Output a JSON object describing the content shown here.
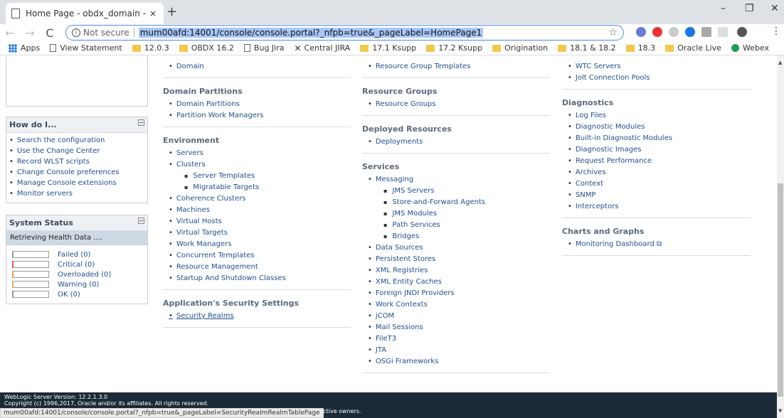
{
  "browser": {
    "tab_title": "Home Page - obdx_domain - WL",
    "tab_close": "×",
    "new_tab": "+",
    "minimize": "–",
    "restore": "❐",
    "close": "✕",
    "back": "←",
    "forward": "→",
    "reload": "C",
    "info_glyph": "i",
    "not_secure": "Not secure",
    "url": "mum00afd:14001/console/console.portal?_nfpb=true&_pageLabel=HomePage1",
    "star": "☆",
    "menu": "⋮",
    "bookmarks": [
      {
        "label": "Apps",
        "icon": "apps-icon"
      },
      {
        "label": "View Statement",
        "icon": "page-icon"
      },
      {
        "label": "12.0.3",
        "icon": "folder-icon"
      },
      {
        "label": "OBDX 16.2",
        "icon": "folder-icon"
      },
      {
        "label": "Bug Jira",
        "icon": "page-icon"
      },
      {
        "label": "Central JIRA",
        "icon": "jira-icon"
      },
      {
        "label": "17.1 Ksupp",
        "icon": "folder-icon"
      },
      {
        "label": "17.2 Ksupp",
        "icon": "folder-icon"
      },
      {
        "label": "Origination",
        "icon": "folder-icon"
      },
      {
        "label": "18.1 & 18.2",
        "icon": "folder-icon"
      },
      {
        "label": "18.3",
        "icon": "folder-icon"
      },
      {
        "label": "Oracle Live",
        "icon": "folder-icon"
      },
      {
        "label": "Webex",
        "icon": "webex-icon"
      }
    ]
  },
  "left": {
    "howdoi_title": "How do I...",
    "howdoi_items": [
      "Search the configuration",
      "Use the Change Center",
      "Record WLST scripts",
      "Change Console preferences",
      "Manage Console extensions",
      "Monitor servers"
    ],
    "status_title": "System Status",
    "retrieving": "Retrieving Health Data ....",
    "health": [
      {
        "label": "Failed (0)",
        "color": "#999999"
      },
      {
        "label": "Critical (0)",
        "color": "#d9534f"
      },
      {
        "label": "Overloaded (0)",
        "color": "#e8a33d"
      },
      {
        "label": "Warning (0)",
        "color": "#e0b84a"
      },
      {
        "label": "OK (0)",
        "color": "#999999"
      }
    ]
  },
  "col1": [
    {
      "title": "",
      "items": [
        {
          "label": "Domain"
        }
      ]
    },
    {
      "title": "Domain Partitions",
      "items": [
        {
          "label": "Domain Partitions"
        },
        {
          "label": "Partition Work Managers"
        }
      ]
    },
    {
      "title": "Environment",
      "items": [
        {
          "label": "Servers"
        },
        {
          "label": "Clusters"
        },
        {
          "label": "Server Templates",
          "sub": true
        },
        {
          "label": "Migratable Targets",
          "sub": true
        },
        {
          "label": "Coherence Clusters"
        },
        {
          "label": "Machines"
        },
        {
          "label": "Virtual Hosts"
        },
        {
          "label": "Virtual Targets"
        },
        {
          "label": "Work Managers"
        },
        {
          "label": "Concurrent Templates"
        },
        {
          "label": "Resource Management"
        },
        {
          "label": "Startup And Shutdown Classes"
        }
      ]
    },
    {
      "title": "Application's Security Settings",
      "items": [
        {
          "label": "Security Realms",
          "u": true
        }
      ]
    }
  ],
  "col2": [
    {
      "title": "",
      "items": [
        {
          "label": "Resource Group Templates"
        }
      ]
    },
    {
      "title": "Resource Groups",
      "items": [
        {
          "label": "Resource Groups"
        }
      ]
    },
    {
      "title": "Deployed Resources",
      "items": [
        {
          "label": "Deployments"
        }
      ]
    },
    {
      "title": "Services",
      "items": [
        {
          "label": "Messaging"
        },
        {
          "label": "JMS Servers",
          "sub": true
        },
        {
          "label": "Store-and-Forward Agents",
          "sub": true
        },
        {
          "label": "JMS Modules",
          "sub": true
        },
        {
          "label": "Path Services",
          "sub": true
        },
        {
          "label": "Bridges",
          "sub": true
        },
        {
          "label": "Data Sources"
        },
        {
          "label": "Persistent Stores"
        },
        {
          "label": "XML Registries"
        },
        {
          "label": "XML Entity Caches"
        },
        {
          "label": "Foreign JNDI Providers"
        },
        {
          "label": "Work Contexts"
        },
        {
          "label": "jCOM"
        },
        {
          "label": "Mail Sessions"
        },
        {
          "label": "FileT3"
        },
        {
          "label": "JTA"
        },
        {
          "label": "OSGi Frameworks"
        }
      ]
    }
  ],
  "col3": [
    {
      "title": "",
      "items": [
        {
          "label": "WTC Servers"
        },
        {
          "label": "Jolt Connection Pools"
        }
      ]
    },
    {
      "title": "Diagnostics",
      "items": [
        {
          "label": "Log Files"
        },
        {
          "label": "Diagnostic Modules"
        },
        {
          "label": "Built-in Diagnostic Modules"
        },
        {
          "label": "Diagnostic Images"
        },
        {
          "label": "Request Performance"
        },
        {
          "label": "Archives"
        },
        {
          "label": "Context"
        },
        {
          "label": "SNMP"
        },
        {
          "label": "Interceptors"
        }
      ]
    },
    {
      "title": "Charts and Graphs",
      "items": [
        {
          "label": "Monitoring Dashboard ⧉"
        }
      ]
    }
  ],
  "footer": {
    "version": "WebLogic Server Version: 12.2.1.3.0",
    "copyright": "Copyright (c) 1996,2017, Oracle and/or its affiliates. All rights reserved.",
    "owners": "respective owners.",
    "status_url": "mum00afd:14001/console/console.portal?_nfpb=true&_pageLabel=SecurityRealmRealmTablePage"
  }
}
